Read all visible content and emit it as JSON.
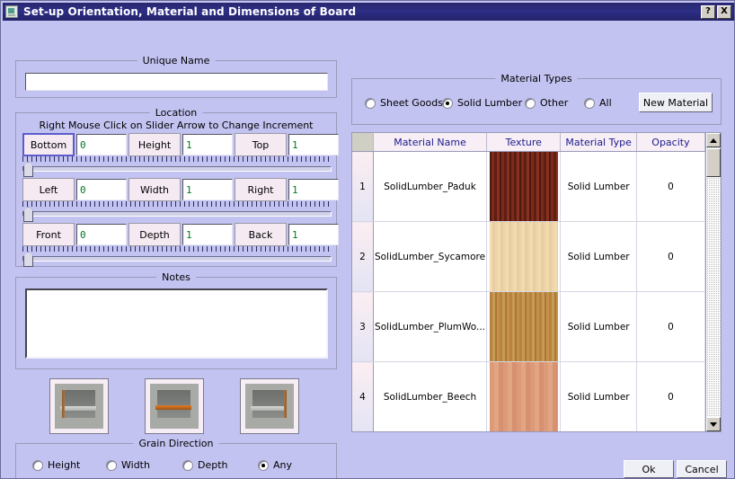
{
  "window": {
    "title": "Set-up Orientation, Material and Dimensions of Board",
    "icon": "window-icon",
    "help_label": "?",
    "close_label": "X"
  },
  "unique_name": {
    "group_title": "Unique Name",
    "value": "",
    "placeholder": ""
  },
  "location": {
    "group_title": "Location",
    "hint": "Right Mouse Click on Slider Arrow to Change Increment",
    "rows": [
      {
        "start_label": "Bottom",
        "start_value": "0",
        "size_label": "Height",
        "size_value": "1",
        "end_label": "Top",
        "end_value": "1"
      },
      {
        "start_label": "Left",
        "start_value": "0",
        "size_label": "Width",
        "size_value": "1",
        "end_label": "Right",
        "end_value": "1"
      },
      {
        "start_label": "Front",
        "start_value": "0",
        "size_label": "Depth",
        "size_value": "1",
        "end_label": "Back",
        "end_value": "1"
      }
    ]
  },
  "notes": {
    "group_title": "Notes",
    "value": ""
  },
  "orientation_previews": [
    {
      "name": "orientation-vertical-left"
    },
    {
      "name": "orientation-horizontal"
    },
    {
      "name": "orientation-vertical-right"
    }
  ],
  "grain_direction": {
    "group_title": "Grain Direction",
    "options": [
      {
        "label": "Height",
        "selected": false
      },
      {
        "label": "Width",
        "selected": false
      },
      {
        "label": "Depth",
        "selected": false
      },
      {
        "label": "Any",
        "selected": true
      }
    ]
  },
  "material_types": {
    "group_title": "Material Types",
    "options": [
      {
        "label": "Sheet Goods",
        "selected": false
      },
      {
        "label": "Solid Lumber",
        "selected": true
      },
      {
        "label": "Other",
        "selected": false
      },
      {
        "label": "All",
        "selected": false
      }
    ],
    "new_material_label": "New Material"
  },
  "material_table": {
    "columns": [
      "Material Name",
      "Texture",
      "Material Type",
      "Opacity"
    ],
    "rows": [
      {
        "num": "1",
        "name": "SolidLumber_Paduk",
        "texture": "paduk",
        "type": "Solid Lumber",
        "opacity": "0"
      },
      {
        "num": "2",
        "name": "SolidLumber_Sycamore",
        "texture": "sycamore",
        "type": "Solid Lumber",
        "opacity": "0"
      },
      {
        "num": "3",
        "name": "SolidLumber_PlumWo...",
        "texture": "plumwood",
        "type": "Solid Lumber",
        "opacity": "0"
      },
      {
        "num": "4",
        "name": "SolidLumber_Beech",
        "texture": "beech",
        "type": "Solid Lumber",
        "opacity": "0"
      }
    ],
    "scrollbar": {
      "up_label": "up-arrow",
      "down_label": "down-arrow"
    }
  },
  "dialog_buttons": {
    "ok_label": "Ok",
    "cancel_label": "Cancel"
  },
  "colors": {
    "dialog_background": "#c3c3f2",
    "titlebar": "#2a2a78",
    "header_text": "#1b1b8c",
    "field_text": "#00781f",
    "paduk": "#6b2116",
    "sycamore": "#efd6a8",
    "plumwood": "#c08f4a",
    "beech": "#dd9a78"
  }
}
